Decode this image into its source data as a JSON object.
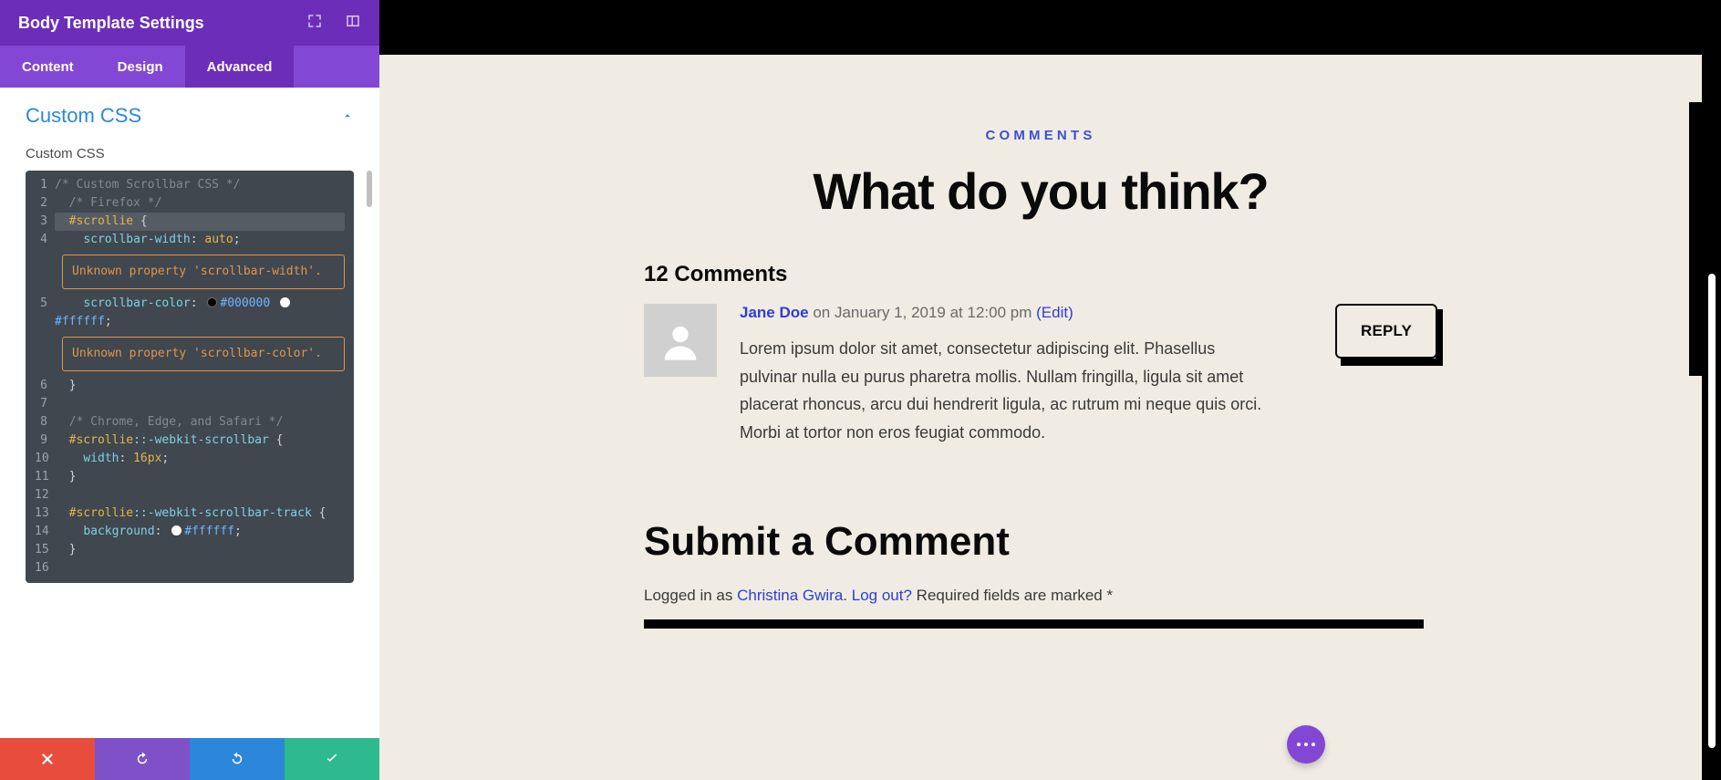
{
  "sidebar": {
    "title": "Body Template Settings",
    "tabs": [
      "Content",
      "Design",
      "Advanced"
    ],
    "active_tab": 2,
    "section_title": "Custom CSS",
    "field_label": "Custom CSS",
    "code": {
      "l1": "/* Custom Scrollbar CSS */",
      "l2": "/* Firefox */",
      "l3_sel": "#scrollie",
      "l3_brace": " {",
      "l4_prop": "scrollbar-width",
      "l4_val": "auto",
      "warn1": "Unknown property 'scrollbar-width'.",
      "l5_prop": "scrollbar-color",
      "l5_hex1": "#000000",
      "l5_hex2": "#ffffff",
      "warn2": "Unknown property 'scrollbar-color'.",
      "l6": "}",
      "l8": "/* Chrome, Edge, and Safari */",
      "l9_sel": "#scrollie",
      "l9_pseudo": "::-webkit-scrollbar",
      "l9_brace": " {",
      "l10_prop": "width",
      "l10_val": "16px",
      "l11": "}",
      "l13_sel": "#scrollie",
      "l13_pseudo": "::-webkit-scrollbar-track",
      "l13_brace": " {",
      "l14_prop": "background",
      "l14_hex": "#ffffff",
      "l15": "}"
    }
  },
  "preview": {
    "eyebrow": "COMMENTS",
    "heading": "What do you think?",
    "count": "12 Comments",
    "comment": {
      "author": "Jane Doe",
      "date": "on January 1, 2019 at 12:00 pm",
      "edit": "(Edit)",
      "text": "Lorem ipsum dolor sit amet, consectetur adipiscing elit. Phasellus pulvinar nulla eu purus pharetra mollis. Nullam fringilla, ligula sit amet placerat rhoncus, arcu dui hendrerit ligula, ac rutrum mi neque quis orci. Morbi at tortor non eros feugiat commodo.",
      "reply": "REPLY"
    },
    "submit_heading": "Submit a Comment",
    "login": {
      "prefix": "Logged in as ",
      "name": "Christina Gwira",
      "sep": ". ",
      "logout": "Log out?",
      "suffix": " Required fields are marked *"
    }
  }
}
